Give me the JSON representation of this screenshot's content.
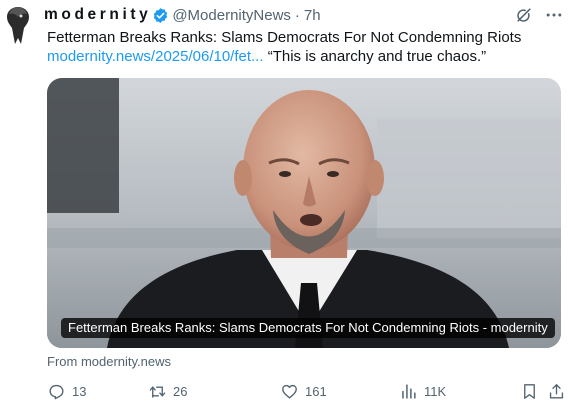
{
  "post": {
    "display_name": "modernity",
    "handle": "@ModernityNews",
    "separator": "·",
    "time": "7h",
    "text_title": "Fetterman Breaks Ranks: Slams Democrats For Not Condemning Riots",
    "link_text": "modernity.news/2025/06/10/fet...",
    "quote": "“This is anarchy and true chaos.”"
  },
  "card": {
    "caption": "Fetterman Breaks Ranks: Slams Democrats For Not Condemning Riots - modernity",
    "source": "From modernity.news"
  },
  "actions": {
    "replies": "13",
    "reposts": "26",
    "likes": "161",
    "views": "11K"
  },
  "icons": {
    "verified": "verified-badge-icon",
    "grok": "grok-icon",
    "more": "more-icon",
    "reply": "reply-icon",
    "repost": "repost-icon",
    "like": "heart-icon",
    "views": "views-icon",
    "bookmark": "bookmark-icon",
    "share": "share-icon"
  },
  "colors": {
    "text": "#0f1419",
    "secondary": "#536471",
    "link": "#1d9bf0",
    "verified": "#1d9bf0"
  }
}
